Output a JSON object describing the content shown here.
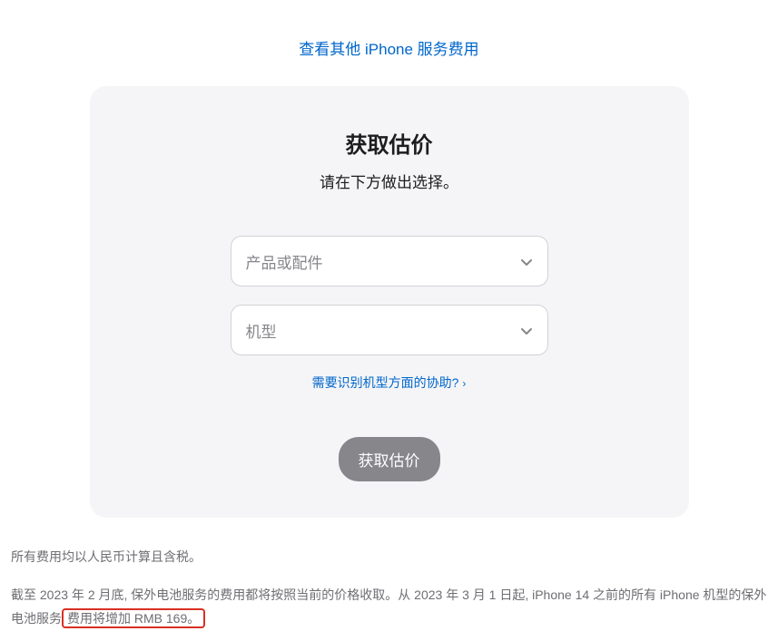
{
  "topLink": {
    "label": "查看其他 iPhone 服务费用"
  },
  "card": {
    "title": "获取估价",
    "subtitle": "请在下方做出选择。",
    "productSelect": {
      "placeholder": "产品或配件"
    },
    "modelSelect": {
      "placeholder": "机型"
    },
    "helpLink": {
      "label": "需要识别机型方面的协助?"
    },
    "submitButton": {
      "label": "获取估价"
    }
  },
  "footer": {
    "line1": "所有费用均以人民币计算且含税。",
    "line2_part1": "截至 2023 年 2 月底, 保外电池服务的费用都将按照当前的价格收取。从 2023 年 3 月 1 日起, iPhone 14 之前的所有 iPhone 机型的保外电池服务",
    "line2_highlight": "费用将增加 RMB 169。"
  }
}
